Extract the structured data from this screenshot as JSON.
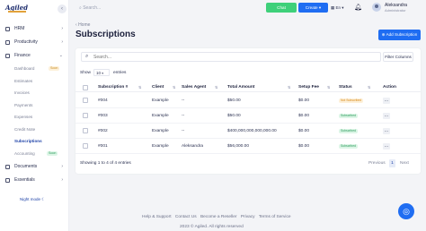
{
  "app": {
    "logo_text": "Agiled"
  },
  "sidebar": {
    "items": [
      {
        "label": "HRM",
        "icon": "people-icon"
      },
      {
        "label": "Productivity",
        "icon": "briefcase-icon"
      },
      {
        "label": "Finance",
        "icon": "wallet-icon"
      }
    ],
    "finance_sub": [
      {
        "label": "Dashboard",
        "badge": "Soon"
      },
      {
        "label": "Estimates"
      },
      {
        "label": "Invoices"
      },
      {
        "label": "Payments"
      },
      {
        "label": "Expenses"
      },
      {
        "label": "Credit Note"
      },
      {
        "label": "Subscriptions",
        "active": true
      },
      {
        "label": "Accounting",
        "badge": "Soon"
      }
    ],
    "bottom_items": [
      {
        "label": "Documents",
        "icon": "document-icon"
      },
      {
        "label": "Essentials",
        "icon": "star-icon"
      }
    ],
    "night_mode": "Night mode"
  },
  "topbar": {
    "search_placeholder": "Search...",
    "green_btn": "Chat",
    "create_btn": "Create",
    "lang": "En",
    "user_name": "Aleksandra",
    "user_role": "Administrator"
  },
  "page": {
    "breadcrumb": "Home",
    "title": "Subscriptions",
    "add_button": "Add Subscription"
  },
  "table_controls": {
    "search_placeholder": "Search...",
    "filter_button": "Filter Columns",
    "show_label": "Show",
    "show_value": "10",
    "entries_label": "entries"
  },
  "table": {
    "headers": [
      "Subscription #",
      "Client",
      "Sales Agent",
      "Total Amount",
      "Setup Fee",
      "Status",
      "Action"
    ],
    "rows": [
      {
        "id": "#004",
        "client": "Example",
        "agent": "--",
        "total": "$50.00",
        "setup": "$0.00",
        "status": "Not Subscribed",
        "status_type": "unpaid"
      },
      {
        "id": "#003",
        "client": "Example",
        "agent": "--",
        "total": "$50.00",
        "setup": "$0.00",
        "status": "Subscribed",
        "status_type": "paid"
      },
      {
        "id": "#002",
        "client": "Example",
        "agent": "--",
        "total": "$400,000,000,000,000.00",
        "setup": "$0.00",
        "status": "Subscribed",
        "status_type": "paid"
      },
      {
        "id": "#001",
        "client": "Example",
        "agent": "Aleksandra",
        "total": "$56,000.00",
        "setup": "$0.00",
        "status": "Subscribed",
        "status_type": "paid"
      }
    ],
    "action_label": "...",
    "info": "Showing 1 to 4 of 4 entries",
    "pagination": {
      "prev": "Previous",
      "current": "1",
      "next": "Next"
    }
  },
  "footer": {
    "links": [
      "Help & Support",
      "Contact Us",
      "Become a Reseller",
      "Privacy",
      "Terms of Service"
    ],
    "copyright": "2023 © Agiled. All rights reserved"
  },
  "colors": {
    "primary": "#1f6df2",
    "success": "#3ed07a",
    "warning": "#d98a1a"
  }
}
